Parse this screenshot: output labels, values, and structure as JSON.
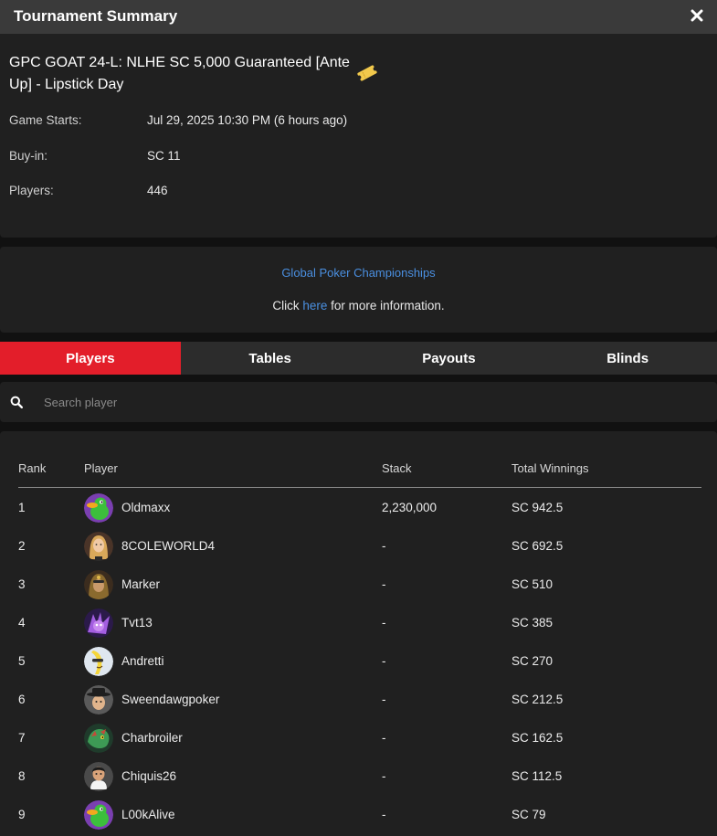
{
  "header": {
    "title": "Tournament Summary",
    "close_icon": "close-icon"
  },
  "tournament": {
    "name": "GPC GOAT 24-L: NLHE SC 5,000 Guaranteed [Ante Up] - Lipstick Day",
    "ticket_icon": "ticket-icon",
    "details": [
      {
        "label": "Game Starts:",
        "value": "Jul 29, 2025 10:30 PM (6 hours ago)"
      },
      {
        "label": "Buy-in:",
        "value": "SC 11"
      },
      {
        "label": "Players:",
        "value": "446"
      }
    ]
  },
  "series": {
    "name": "Global Poker Championships",
    "more_prefix": "Click ",
    "more_link": "here",
    "more_suffix": " for more information."
  },
  "tabs": [
    {
      "label": "Players",
      "active": true
    },
    {
      "label": "Tables",
      "active": false
    },
    {
      "label": "Payouts",
      "active": false
    },
    {
      "label": "Blinds",
      "active": false
    }
  ],
  "search": {
    "placeholder": "Search player",
    "value": ""
  },
  "table": {
    "columns": [
      "Rank",
      "Player",
      "Stack",
      "Total Winnings"
    ],
    "rows": [
      {
        "rank": "1",
        "player": "Oldmaxx",
        "stack": "2,230,000",
        "winnings": "SC 942.5",
        "avatar": "duck-avatar"
      },
      {
        "rank": "2",
        "player": "8COLEWORLD4",
        "stack": "-",
        "winnings": "SC 692.5",
        "avatar": "woman-avatar"
      },
      {
        "rank": "3",
        "player": "Marker",
        "stack": "-",
        "winnings": "SC 510",
        "avatar": "hooded-avatar"
      },
      {
        "rank": "4",
        "player": "Tvt13",
        "stack": "-",
        "winnings": "SC 385",
        "avatar": "purple-creature-avatar"
      },
      {
        "rank": "5",
        "player": "Andretti",
        "stack": "-",
        "winnings": "SC 270",
        "avatar": "banana-avatar"
      },
      {
        "rank": "6",
        "player": "Sweendawgpoker",
        "stack": "-",
        "winnings": "SC 212.5",
        "avatar": "fedora-man-avatar"
      },
      {
        "rank": "7",
        "player": "Charbroiler",
        "stack": "-",
        "winnings": "SC 162.5",
        "avatar": "dragon-avatar"
      },
      {
        "rank": "8",
        "player": "Chiquis26",
        "stack": "-",
        "winnings": "SC 112.5",
        "avatar": "man-avatar"
      },
      {
        "rank": "9",
        "player": "L00kAlive",
        "stack": "-",
        "winnings": "SC 79",
        "avatar": "duck-avatar"
      }
    ]
  },
  "colors": {
    "accent": "#e31e2a",
    "link": "#4a8fe0",
    "panel": "#202020",
    "background": "#111111",
    "header": "#3a3a3a"
  }
}
